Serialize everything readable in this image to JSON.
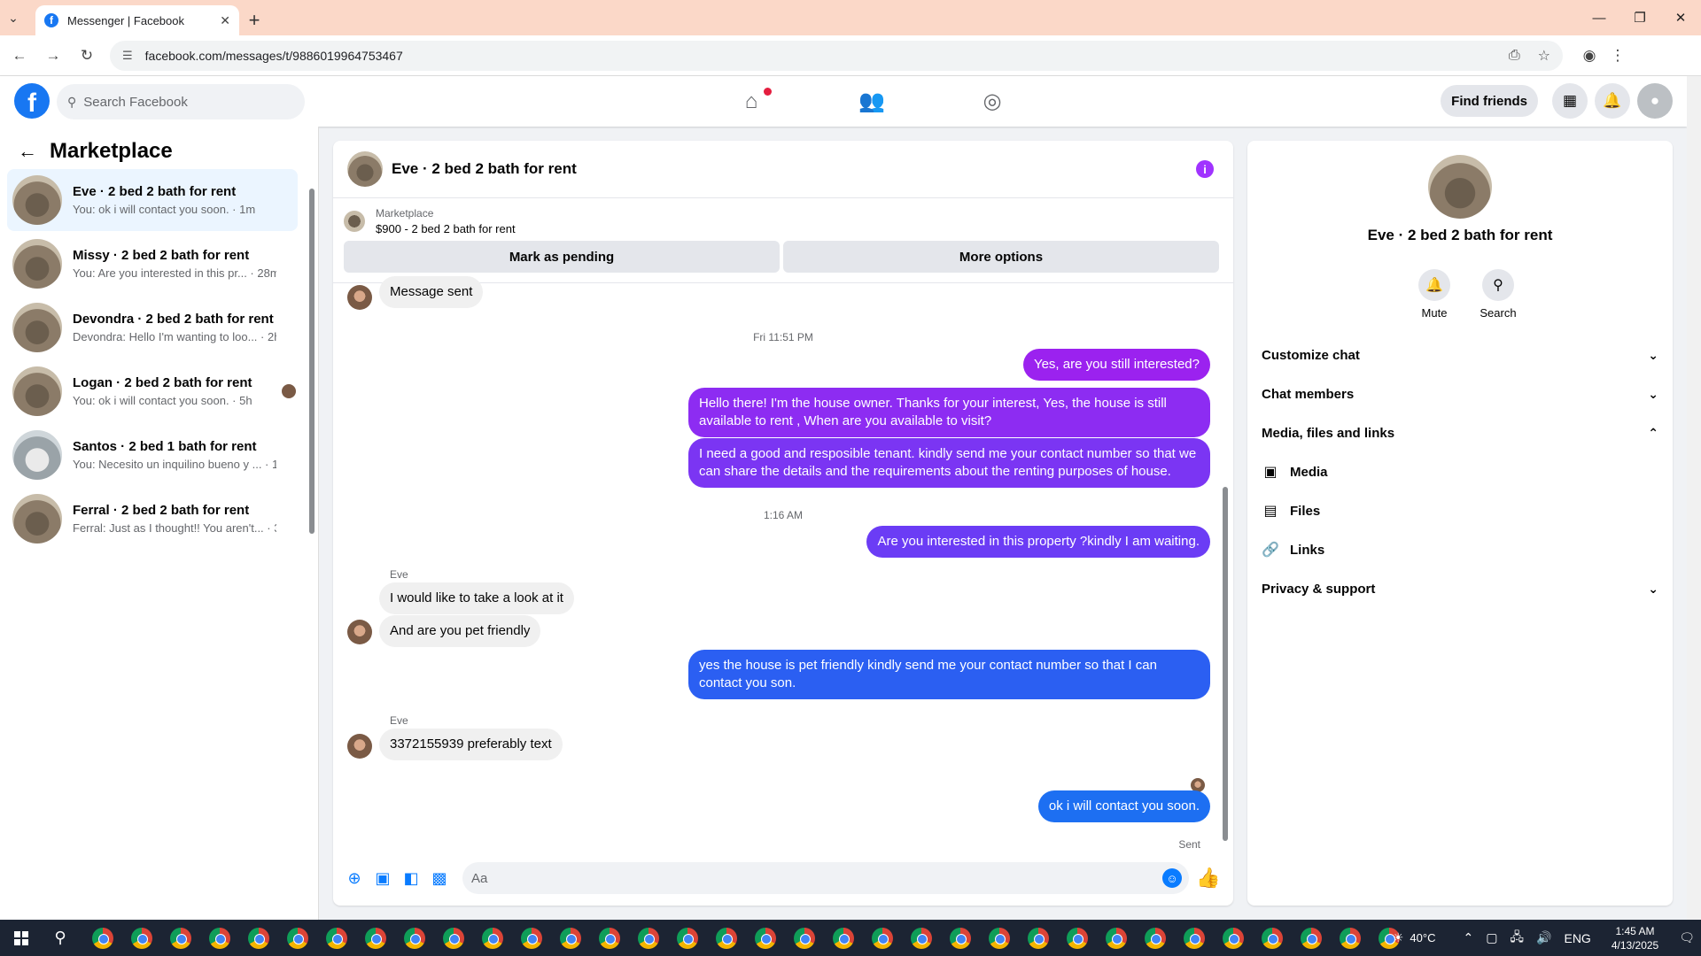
{
  "browser": {
    "tab_title": "Messenger | Facebook",
    "url": "facebook.com/messages/t/9886019964753467"
  },
  "fbnav": {
    "search_placeholder": "Search Facebook",
    "find_friends": "Find friends"
  },
  "left": {
    "title": "Marketplace",
    "conversations": [
      {
        "name": "Eve · 2 bed 2 bath for rent",
        "preview": "You: ok i will contact you soon. · 1m"
      },
      {
        "name": "Missy · 2 bed 2 bath for rent",
        "preview": "You: Are you interested in this pr... · 28m"
      },
      {
        "name": "Devondra · 2 bed 2 bath for rent",
        "preview": "Devondra: Hello I'm wanting to loo... · 2h"
      },
      {
        "name": "Logan · 2 bed 2 bath for rent",
        "preview": "You: ok i will contact you soon. · 5h"
      },
      {
        "name": "Santos · 2 bed 1 bath for rent",
        "preview": "You: Necesito un inquilino bueno y ... · 1d"
      },
      {
        "name": "Ferral · 2 bed 2 bath for rent",
        "preview": "Ferral: Just as I thought!! You aren't... · 3d"
      }
    ]
  },
  "chat": {
    "title": "Eve · 2 bed 2 bath for rent",
    "listing_source": "Marketplace",
    "listing_price": "$900 - 2 bed 2 bath for rent",
    "mark_pending": "Mark as pending",
    "more_options": "More options",
    "messages": {
      "m0": "Message sent",
      "ts1": "Fri 11:51 PM",
      "m1": "Yes, are you still interested?",
      "m2": "Hello there! I'm the house owner. Thanks for your interest, Yes, the house is still available to rent , When are you available to visit?",
      "m3": "I need a good and resposible tenant.  kindly send me your contact number so that we can share the details and the requirements about the renting purposes of house.",
      "ts2": "1:16 AM",
      "m4": "Are you interested in this property ?kindly I am waiting.",
      "sender1": "Eve",
      "m5": "I would like to take a look at it",
      "m6": "And are you pet friendly",
      "m7": "yes the house is pet friendly kindly send me your contact number so that I can contact you son.",
      "sender2": "Eve",
      "m8": "3372155939 preferably text",
      "m9": "ok i will contact you soon.",
      "sent": "Sent"
    },
    "composer_placeholder": "Aa"
  },
  "right": {
    "name": "Eve · 2 bed 2 bath for rent",
    "mute": "Mute",
    "search": "Search",
    "customize": "Customize chat",
    "members": "Chat members",
    "media_section": "Media, files and links",
    "media": "Media",
    "files": "Files",
    "links": "Links",
    "privacy": "Privacy & support"
  },
  "taskbar": {
    "temp": "40°C",
    "lang": "ENG",
    "time": "1:45 AM",
    "date": "4/13/2025"
  },
  "colors": {
    "fb_blue": "#1877f2",
    "bubble_purple": "#9b22ef",
    "bubble_violet": "#6b3cf5",
    "bubble_blue": "#1d6ff2"
  }
}
